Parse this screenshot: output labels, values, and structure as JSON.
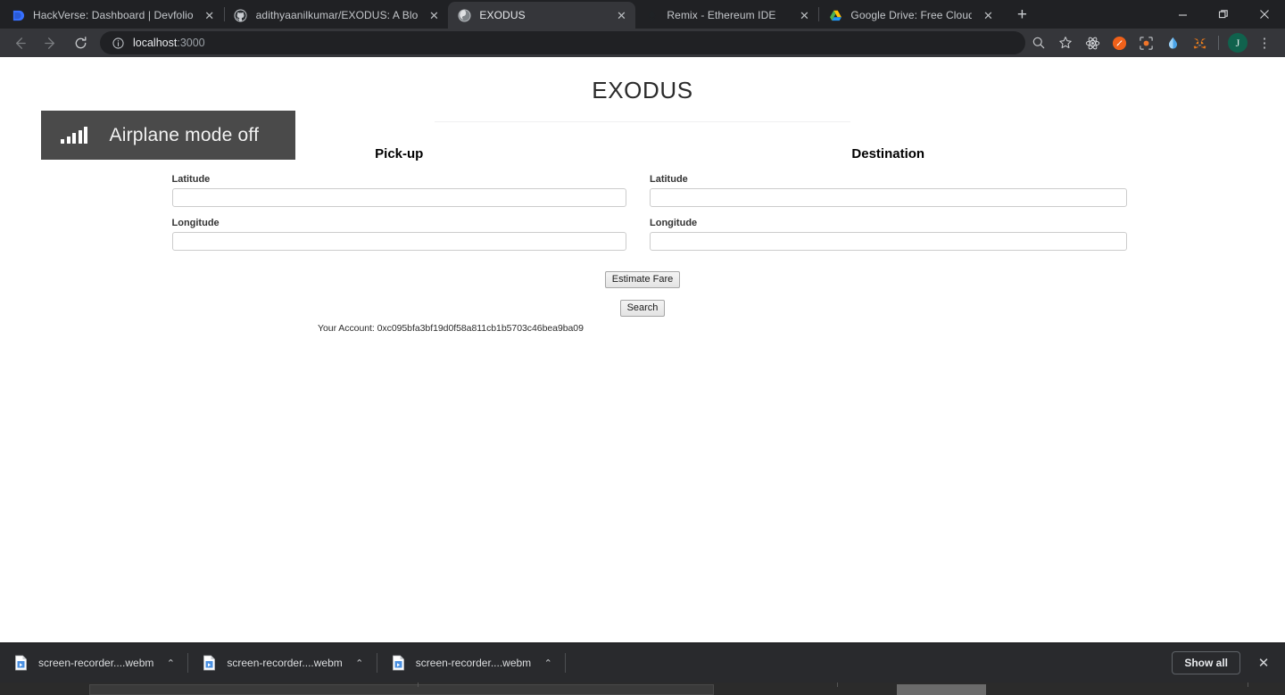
{
  "window": {
    "controls": {
      "minimize": "—",
      "restore": "❐",
      "close": "✕"
    }
  },
  "tabs": [
    {
      "title": "HackVerse: Dashboard | Devfolio",
      "favicon": "devfolio-icon",
      "active": false,
      "close": "✕"
    },
    {
      "title": "adithyaanilkumar/EXODUS: A Blo",
      "favicon": "github-icon",
      "active": false,
      "close": "✕"
    },
    {
      "title": "EXODUS",
      "favicon": "globe-icon",
      "active": true,
      "close": "✕"
    },
    {
      "title": "Remix - Ethereum IDE",
      "favicon": "ethereum-icon",
      "active": false,
      "close": "✕"
    },
    {
      "title": "Google Drive: Free Cloud Storage",
      "favicon": "google-drive-icon",
      "active": false,
      "close": "✕"
    }
  ],
  "newtab_label": "+",
  "toolbar": {
    "back": "←",
    "forward": "→",
    "reload": "⟳",
    "site_info": "ⓘ",
    "url_host": "localhost",
    "url_port": ":3000",
    "search_icon": "⚲",
    "bookmark_icon": "☆",
    "extensions": [
      {
        "name": "react-devtools-icon"
      },
      {
        "name": "brave-rewards-icon"
      },
      {
        "name": "screenshot-icon"
      },
      {
        "name": "water-drop-icon"
      },
      {
        "name": "metamask-fox-icon"
      }
    ],
    "profile_initial": "J",
    "menu_icon": "⋮"
  },
  "toast": {
    "icon": "signal-bars-icon",
    "message": "Airplane mode off"
  },
  "page": {
    "title": "EXODUS",
    "columns": [
      {
        "heading": "Pick-up",
        "fields": [
          {
            "label": "Latitude",
            "value": "",
            "placeholder": ""
          },
          {
            "label": "Longitude",
            "value": "",
            "placeholder": ""
          }
        ]
      },
      {
        "heading": "Destination",
        "fields": [
          {
            "label": "Latitude",
            "value": "",
            "placeholder": ""
          },
          {
            "label": "Longitude",
            "value": "",
            "placeholder": ""
          }
        ]
      }
    ],
    "estimate_fare_label": "Estimate Fare",
    "search_label": "Search",
    "account_text": "Your Account: 0xc095bfa3bf19d0f58a811cb1b5703c46bea9ba09"
  },
  "downloads": {
    "items": [
      {
        "name": "screen-recorder....webm",
        "caret": "⌃"
      },
      {
        "name": "screen-recorder....webm",
        "caret": "⌃"
      },
      {
        "name": "screen-recorder....webm",
        "caret": "⌃"
      }
    ],
    "show_all_label": "Show all",
    "close_label": "✕"
  },
  "colors": {
    "chrome_frame": "#202124",
    "toolbar": "#35363a",
    "omnibox": "#202124",
    "active_tab": "#35363a",
    "page_bg": "#ffffff",
    "toast_bg": "#4a4a4a",
    "shelf_bg": "#292a2d",
    "avatar_bg": "#10624d",
    "input_border": "#cccccc"
  }
}
